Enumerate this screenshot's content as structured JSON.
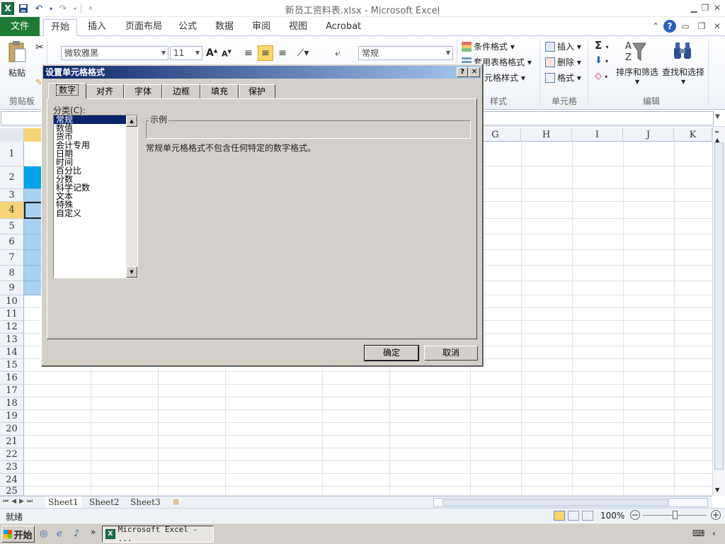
{
  "window": {
    "title": "新员工资料表.xlsx  -  Microsoft Excel",
    "logo_letter": "X"
  },
  "ribbon_tabs": [
    "文件",
    "开始",
    "插入",
    "页面布局",
    "公式",
    "数据",
    "审阅",
    "视图",
    "Acrobat"
  ],
  "ribbon": {
    "paste_label": "粘贴",
    "font_name": "微软雅黑",
    "font_size": "11",
    "grow_font": "A",
    "shrink_font": "A",
    "number_format": "常规",
    "conditional_format": "条件格式",
    "table_format": "套用表格格式",
    "cell_styles": "元格样式",
    "insert": "插入",
    "delete": "删除",
    "format": "格式",
    "sort_filter": "排序和筛选",
    "find_select": "查找和选择",
    "groups": {
      "clipboard": "剪贴板",
      "styles": "样式",
      "cells": "单元格",
      "editing": "编辑"
    }
  },
  "grid": {
    "visible_columns": [
      "G",
      "H",
      "I",
      "J",
      "K"
    ],
    "rows": [
      "1",
      "2",
      "3",
      "4",
      "5",
      "6",
      "7",
      "8",
      "9",
      "10",
      "11",
      "12",
      "13",
      "14",
      "15",
      "16",
      "17",
      "18",
      "19",
      "20",
      "21",
      "22",
      "23",
      "24",
      "25"
    ],
    "filled_cell_color": "#a9d2f2",
    "header_fill_color": "#00a2e8"
  },
  "sheets": [
    "Sheet1",
    "Sheet2",
    "Sheet3"
  ],
  "status": {
    "ready": "就绪",
    "zoom": "100%"
  },
  "dialog": {
    "title": "设置单元格格式",
    "help_btn": "?",
    "close_btn": "✕",
    "tabs": [
      "数字",
      "对齐",
      "字体",
      "边框",
      "填充",
      "保护"
    ],
    "active_tab": "数字",
    "category_label": "分类(C):",
    "categories": [
      "常规",
      "数值",
      "货币",
      "会计专用",
      "日期",
      "时间",
      "百分比",
      "分数",
      "科学记数",
      "文本",
      "特殊",
      "自定义"
    ],
    "selected_category": "常规",
    "sample_label": "示例",
    "description": "常规单元格格式不包含任何特定的数字格式。",
    "ok": "确定",
    "cancel": "取消"
  },
  "taskbar": {
    "start": "开始",
    "excel_task": "Microsoft Excel - ..."
  }
}
